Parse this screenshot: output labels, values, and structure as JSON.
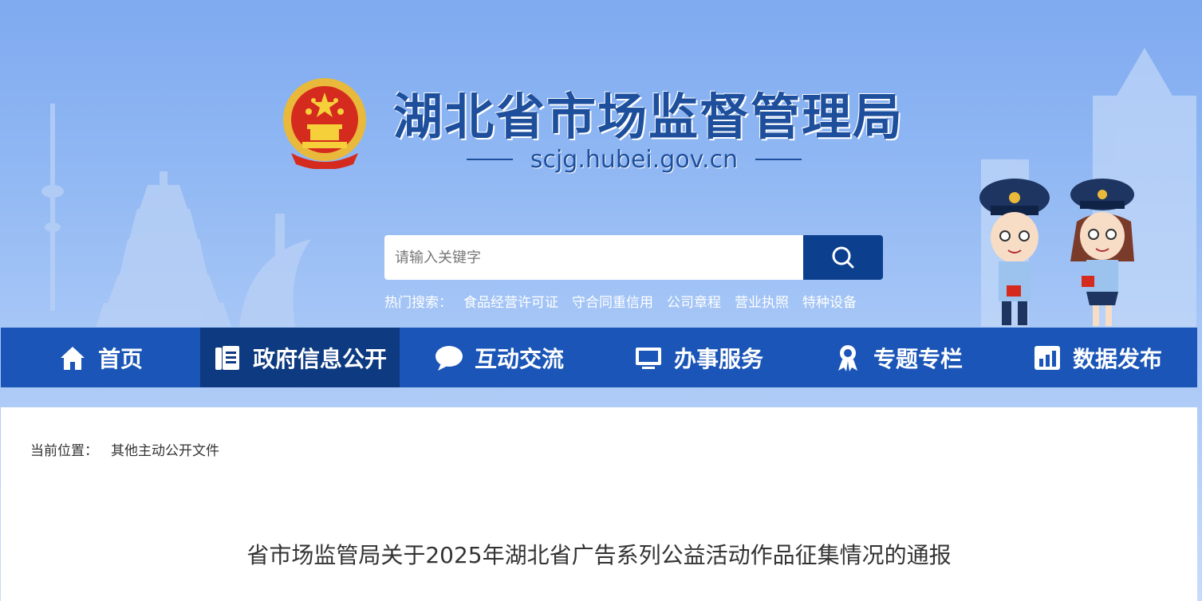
{
  "header": {
    "site_title": "湖北省市场监督管理局",
    "site_domain": "scjg.hubei.gov.cn"
  },
  "search": {
    "placeholder": "请输入关键字",
    "button_icon": "search-icon"
  },
  "hot_search": {
    "label": "热门搜索：",
    "keywords": [
      "食品经营许可证",
      "守合同重信用",
      "公司章程",
      "营业执照",
      "特种设备"
    ]
  },
  "nav": {
    "items": [
      {
        "label": "首页",
        "icon": "home-icon"
      },
      {
        "label": "政府信息公开",
        "icon": "document-icon"
      },
      {
        "label": "互动交流",
        "icon": "chat-icon"
      },
      {
        "label": "办事服务",
        "icon": "monitor-icon"
      },
      {
        "label": "专题专栏",
        "icon": "ribbon-icon"
      },
      {
        "label": "数据发布",
        "icon": "bar-chart-icon"
      }
    ],
    "active_index": 1
  },
  "breadcrumb": {
    "label": "当前位置：",
    "current": "其他主动公开文件"
  },
  "article": {
    "title": "省市场监管局关于2025年湖北省广告系列公益活动作品征集情况的通报"
  },
  "colors": {
    "nav_bg": "#1a55b7",
    "nav_active": "#0d3a80",
    "title_blue": "#1e4f9c",
    "search_button": "#0d3f8f"
  }
}
